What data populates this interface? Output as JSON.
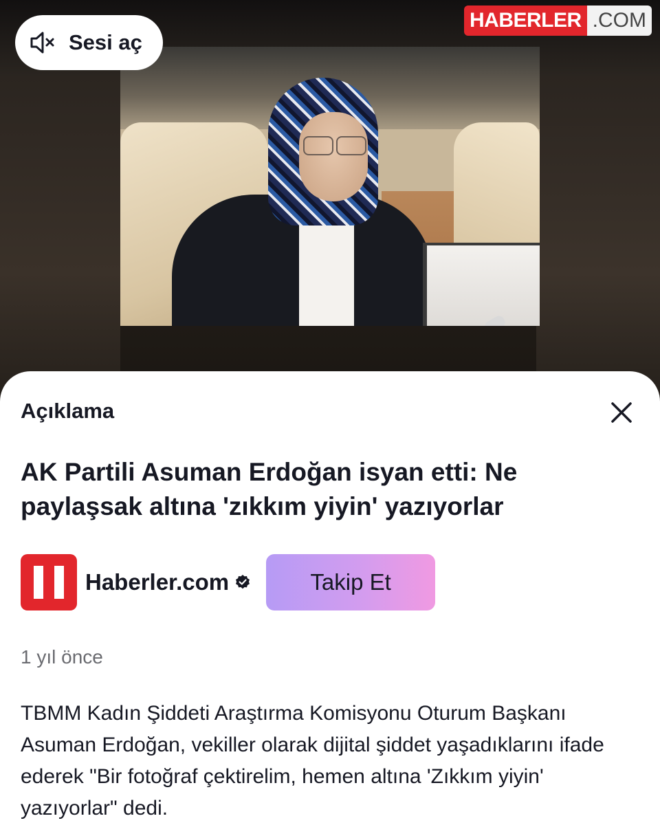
{
  "video": {
    "sound_button_label": "Sesi aç",
    "brand": {
      "red_part": "HABERLER",
      "white_part": ".COM"
    }
  },
  "sheet": {
    "header": "Açıklama",
    "title": "AK Partili Asuman Erdoğan isyan etti: Ne paylaşsak altına 'zıkkım yiyin' yazıyorlar",
    "author": {
      "name": "Haberler.com",
      "verified": true
    },
    "follow_label": "Takip Et",
    "timestamp": "1 yıl önce",
    "description": "TBMM Kadın Şiddeti Araştırma Komisyonu Oturum Başkanı Asuman Erdoğan, vekiller olarak dijital şiddet yaşadıklarını ifade ederek \"Bir fotoğraf çektirelim, hemen altına 'Zıkkım yiyin' yazıyorlar\" dedi."
  },
  "colors": {
    "brand_red": "#e2262c",
    "follow_gradient_start": "#b69bf5",
    "follow_gradient_end": "#f09ae2",
    "text_primary": "#161823",
    "text_secondary": "#6a6b70"
  },
  "icons": {
    "sound": "speaker-muted-icon",
    "close": "close-icon",
    "verified": "verified-badge-icon",
    "author_logo": "haberler-h-logo"
  }
}
